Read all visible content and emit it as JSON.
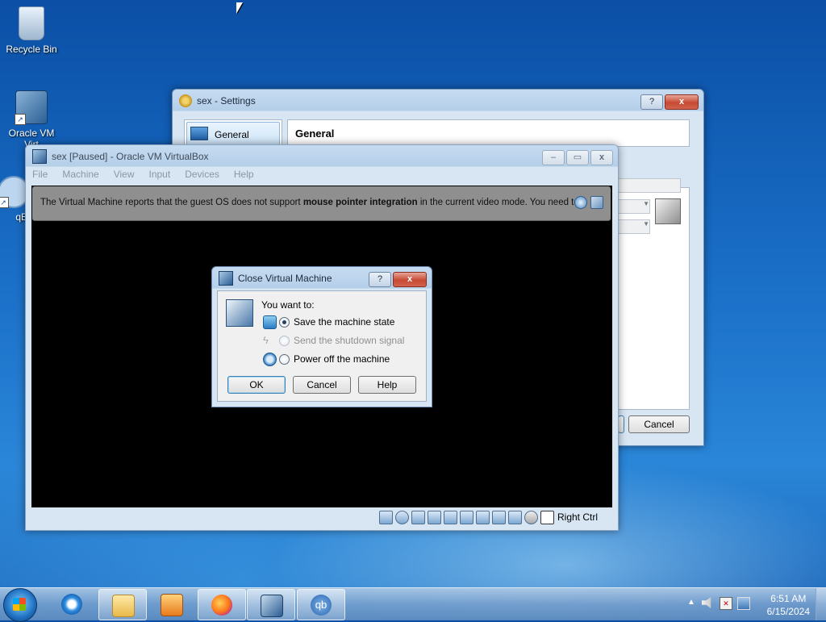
{
  "desktop": {
    "icons": [
      {
        "label": "Recycle Bin"
      },
      {
        "label": "Oracle VM Virt"
      },
      {
        "label": "qBit"
      }
    ]
  },
  "settings_window": {
    "title": "sex - Settings",
    "sidebar_item": "General",
    "section_title": "General",
    "help_btn": "?",
    "close_btn": "x",
    "cancel_button": "Cancel"
  },
  "vm_window": {
    "title": "sex [Paused] - Oracle VM VirtualBox",
    "menu": [
      "File",
      "Machine",
      "View",
      "Input",
      "Devices",
      "Help"
    ],
    "notice_prefix": "The Virtual Machine reports that the guest OS does not support ",
    "notice_bold": "mouse pointer integration",
    "notice_suffix": " in the current video mode. You need to",
    "host_key": "Right Ctrl",
    "minimize": "–",
    "maximize": "▭",
    "close": "x"
  },
  "close_dialog": {
    "title": "Close Virtual Machine",
    "prompt": "You want to:",
    "options": [
      {
        "label": "Save the machine state",
        "selected": true,
        "enabled": true
      },
      {
        "label": "Send the shutdown signal",
        "selected": false,
        "enabled": false
      },
      {
        "label": "Power off the machine",
        "selected": false,
        "enabled": true
      }
    ],
    "ok_button": "OK",
    "cancel_button": "Cancel",
    "help_button": "Help",
    "help_btn": "?",
    "close_btn": "x"
  },
  "taskbar": {
    "pinned": [
      "internet-explorer",
      "file-explorer",
      "media-player",
      "firefox",
      "virtualbox",
      "qbittorrent"
    ],
    "qbit_glyph": "qb"
  },
  "tray": {
    "time": "6:51 AM",
    "date": "6/15/2024"
  }
}
